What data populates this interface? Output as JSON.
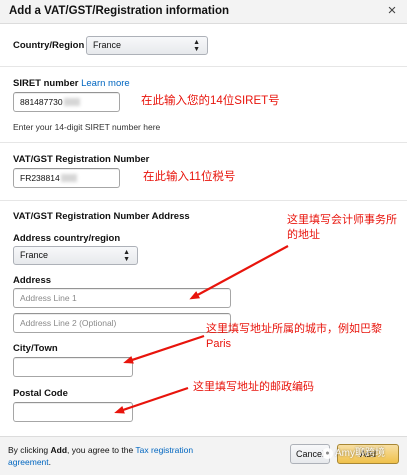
{
  "dialog": {
    "title": "Add a VAT/GST/Registration information",
    "close_glyph": "×"
  },
  "country": {
    "label": "Country/Region",
    "value": "France",
    "caret": "▲▼"
  },
  "siret": {
    "label": "SIRET number",
    "learn_more": "Learn more",
    "value_visible": "881487730",
    "hint": "Enter your 14-digit SIRET number here"
  },
  "vat": {
    "label": "VAT/GST Registration Number",
    "value_visible": "FR238814"
  },
  "address_section": {
    "heading": "VAT/GST Registration Number Address",
    "country_label": "Address country/region",
    "country_value": "France",
    "address_label": "Address",
    "line1_placeholder": "Address Line 1",
    "line2_placeholder": "Address Line 2 (Optional)",
    "city_label": "City/Town",
    "postal_label": "Postal Code"
  },
  "annotations": {
    "siret": "在此输入您的14位SIRET号",
    "vat": "在此输入11位税号",
    "address": "这里填写会计师事务所的地址",
    "city": "这里填写地址所属的城市，例如巴黎Paris",
    "postal": "这里填写地址的邮政编码",
    "color": "#e8140c"
  },
  "footer": {
    "text_prefix": "By clicking ",
    "text_bold": "Add",
    "text_middle": ", you agree to the ",
    "link": "Tax registration agreement",
    "text_suffix": ".",
    "cancel_label": "Cancel",
    "add_label": "Add",
    "watermark": "Amy聊跨境"
  }
}
